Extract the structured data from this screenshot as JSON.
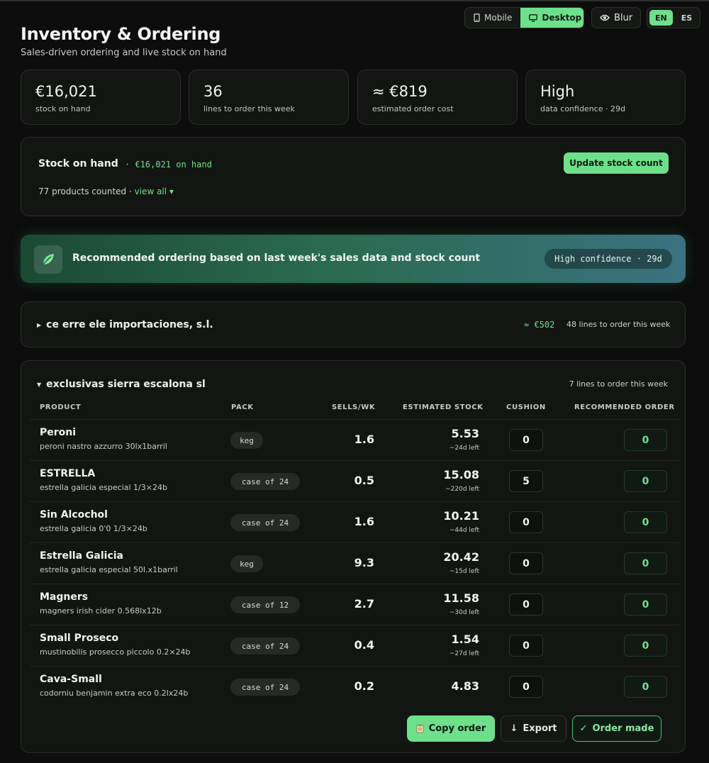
{
  "header": {
    "title": "Inventory & Ordering",
    "subtitle": "Sales-driven ordering and live stock on hand"
  },
  "controls": {
    "device": {
      "mobile_label": "Mobile",
      "desktop_label": "Desktop",
      "selected": "Desktop"
    },
    "blur_label": "Blur",
    "language": {
      "en_label": "EN",
      "es_label": "ES",
      "selected": "EN"
    }
  },
  "stats": [
    {
      "value": "€16,021",
      "label": "stock on hand"
    },
    {
      "value": "36",
      "label": "lines to order this week"
    },
    {
      "value": "≈ €819",
      "label": "estimated order cost"
    },
    {
      "value": "High",
      "label": "data confidence · 29d"
    }
  ],
  "stock_on_hand": {
    "title": "Stock on hand",
    "amount": "· €16,021 on hand",
    "count_text": "77 products counted ·",
    "view_all": "view all ▾",
    "update_button": "Update stock count"
  },
  "recommendation": {
    "text": "Recommended ordering based on last week's sales data and stock count",
    "confidence": "High confidence · 29d"
  },
  "suppliers": [
    {
      "name": "ce erre ele importaciones, s.l.",
      "cost": "≈ €502",
      "lines": "48 lines to order this week",
      "expanded": false
    },
    {
      "name": "exclusivas sierra escalona sl",
      "lines": "7 lines to order this week",
      "expanded": true,
      "columns": [
        "PRODUCT",
        "PACK",
        "SELLS/WK",
        "ESTIMATED STOCK",
        "CUSHION",
        "RECOMMENDED ORDER"
      ],
      "rows": [
        {
          "name": "Peroni",
          "desc": "peroni nastro azzurro 30lx1barril",
          "pack": "keg",
          "sells": "1.6",
          "stock": "5.53",
          "left": "~24d left",
          "cushion": "0",
          "order": "0"
        },
        {
          "name": "ESTRELLA",
          "desc": "estrella galicia especial 1/3×24b",
          "pack": "case of 24",
          "sells": "0.5",
          "stock": "15.08",
          "left": "~220d left",
          "cushion": "5",
          "order": "0"
        },
        {
          "name": "Sin Alcochol",
          "desc": "estrella galicia 0'0 1/3×24b",
          "pack": "case of 24",
          "sells": "1.6",
          "stock": "10.21",
          "left": "~44d left",
          "cushion": "0",
          "order": "0"
        },
        {
          "name": "Estrella Galicia",
          "desc": "estrella galicia especial 50l.x1barril",
          "pack": "keg",
          "sells": "9.3",
          "stock": "20.42",
          "left": "~15d left",
          "cushion": "0",
          "order": "0"
        },
        {
          "name": "Magners",
          "desc": "magners irish cider 0.568lx12b",
          "pack": "case of 12",
          "sells": "2.7",
          "stock": "11.58",
          "left": "~30d left",
          "cushion": "0",
          "order": "0"
        },
        {
          "name": "Small Proseco",
          "desc": "mustinobilis prosecco piccolo 0.2×24b",
          "pack": "case of 24",
          "sells": "0.4",
          "stock": "1.54",
          "left": "~27d left",
          "cushion": "0",
          "order": "0"
        },
        {
          "name": "Cava-Small",
          "desc": "codorniu benjamin extra eco 0.2lx24b",
          "pack": "case of 24",
          "sells": "0.2",
          "stock": "4.83",
          "left": "",
          "cushion": "0",
          "order": "0"
        }
      ],
      "actions": {
        "copy": "Copy order",
        "export": "Export",
        "made": "Order made"
      }
    }
  ],
  "colors": {
    "accent": "#6ee08c",
    "background": "#0c0d0c",
    "card": "#131513"
  },
  "icons": [
    "mobile-icon",
    "desktop-icon",
    "eye-icon",
    "leaf-icon",
    "caret-icon",
    "clipboard-icon",
    "arrow-down-icon",
    "check-icon"
  ]
}
